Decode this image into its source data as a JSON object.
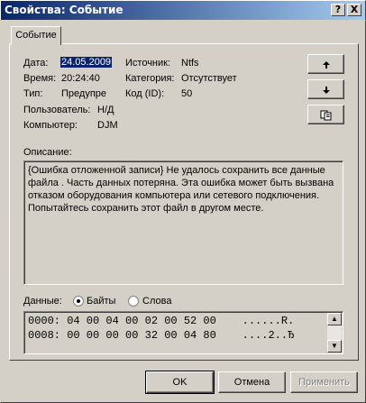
{
  "window": {
    "title": "Свойства: Событие",
    "help_label": "?",
    "close_label": "X"
  },
  "tab": {
    "label": "Событие"
  },
  "fields": {
    "date": {
      "label": "Дата:",
      "value": "24.05.2009"
    },
    "time": {
      "label": "Время:",
      "value": "20:24:40"
    },
    "type": {
      "label": "Тип:",
      "value": "Предупре"
    },
    "user": {
      "label": "Пользователь:",
      "value": "Н/Д"
    },
    "computer": {
      "label": "Компьютер:",
      "value": "DJM"
    },
    "source": {
      "label": "Источник:",
      "value": "Ntfs"
    },
    "category": {
      "label": "Категория:",
      "value": "Отсутствует"
    },
    "event_id": {
      "label": "Код (ID):",
      "value": "50"
    }
  },
  "side_buttons": {
    "up_icon": "up-arrow-icon",
    "down_icon": "down-arrow-icon",
    "copy_icon": "copy-icon"
  },
  "description": {
    "label": "Описание:",
    "text": "{Ошибка отложенной записи} Не удалось сохранить все данные файла . Часть данных потеряна. Эта ошибка может быть вызвана отказом оборудования компьютера или сетевого подключения. Попытайтесь сохранить этот файл в другом месте."
  },
  "data": {
    "label": "Данные:",
    "bytes_label": "Байты",
    "words_label": "Слова",
    "selected": "Байты",
    "lines": [
      "0000: 04 00 04 00 02 00 52 00    ......R.",
      "0008: 00 00 00 00 32 00 04 80    ....2..Ђ"
    ]
  },
  "buttons": {
    "ok": "OK",
    "cancel": "Отмена",
    "apply": "Применить"
  },
  "colors": {
    "titlebar_start": "#0a246a",
    "titlebar_end": "#a6caf0",
    "face": "#d4d0c8",
    "selection": "#0a246a"
  }
}
